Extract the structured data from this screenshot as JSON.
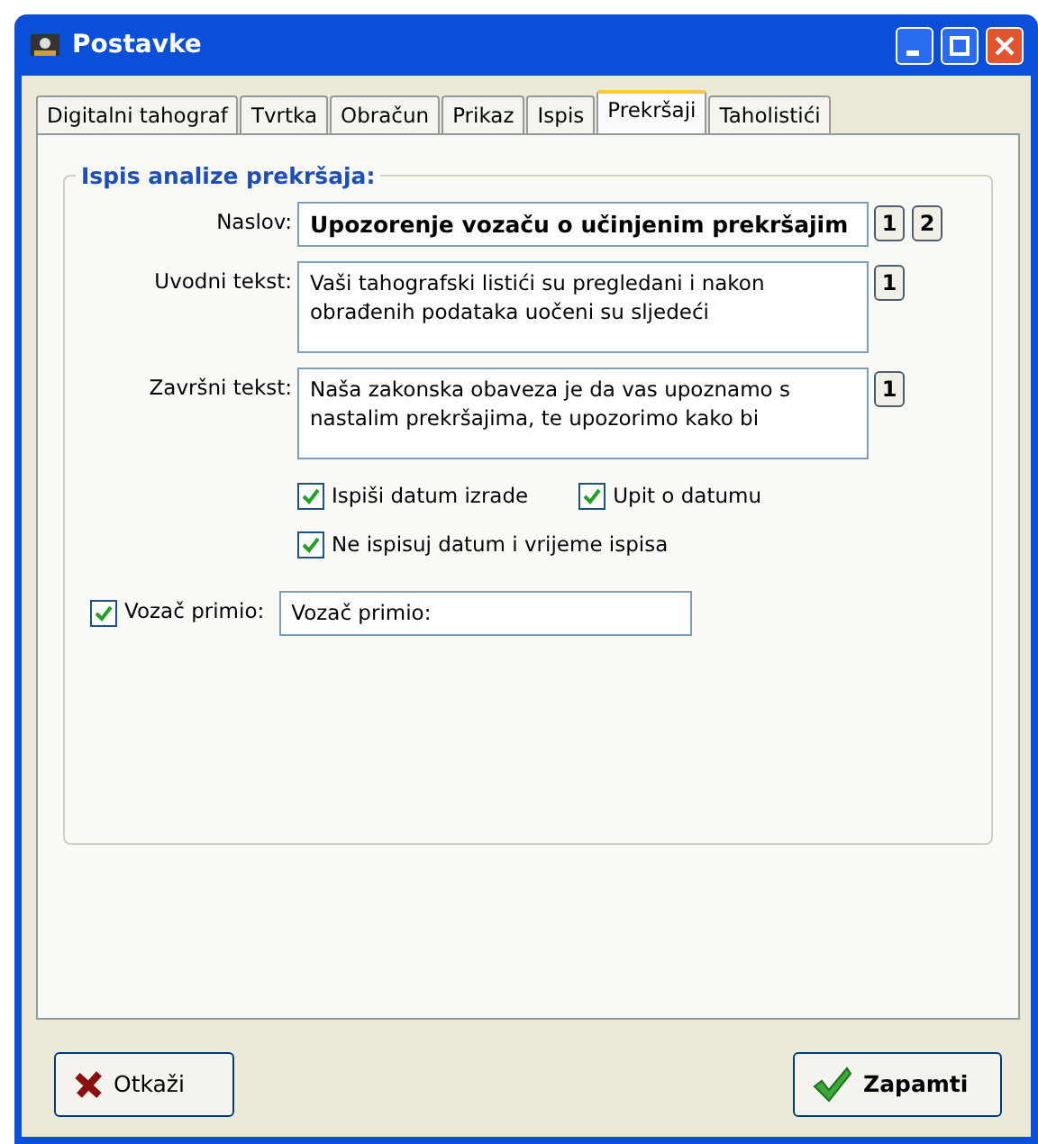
{
  "window": {
    "title": "Postavke"
  },
  "tabs": [
    {
      "label": "Digitalni tahograf",
      "selected": false
    },
    {
      "label": "Tvrtka",
      "selected": false
    },
    {
      "label": "Obračun",
      "selected": false
    },
    {
      "label": "Prikaz",
      "selected": false
    },
    {
      "label": "Ispis",
      "selected": false
    },
    {
      "label": "Prekršaji",
      "selected": true
    },
    {
      "label": "Taholistići",
      "selected": false
    }
  ],
  "group": {
    "title": "Ispis analize prekršaja:",
    "fields": [
      {
        "kind": "line",
        "label": "Naslov:",
        "value": "Upozorenje vozaču o učinjenim prekršajim",
        "buttons": [
          "1",
          "2"
        ]
      },
      {
        "kind": "memo",
        "label": "Uvodni tekst:",
        "value": "Vaši tahografski listići su pregledani i nakon obrađenih podataka uočeni su sljedeći",
        "buttons": [
          "1"
        ]
      },
      {
        "kind": "memo",
        "label": "Završni tekst:",
        "value": "Naša zakonska obaveza je da vas upoznamo s nastalim prekršajima, te upozorimo kako bi",
        "buttons": [
          "1"
        ]
      }
    ],
    "checkboxes": [
      {
        "label": "Ispiši datum izrade",
        "checked": true
      },
      {
        "label": "Upit o datumu",
        "checked": true
      },
      {
        "label": "Ne ispisuj datum i vrijeme ispisa",
        "checked": true
      }
    ],
    "receiver": {
      "label": "Vozač primio:",
      "checked": true,
      "value": "Vozač primio:"
    }
  },
  "buttons": [
    {
      "kind": "cancel",
      "label": "Otkaži"
    },
    {
      "kind": "save",
      "label": "Zapamti"
    }
  ]
}
